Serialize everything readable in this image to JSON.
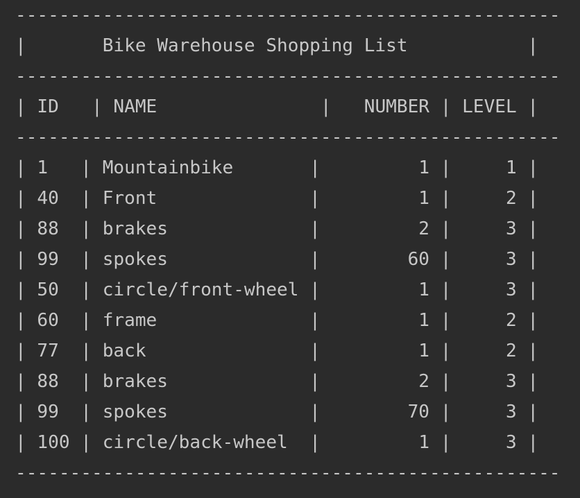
{
  "console": {
    "separator": "--------------------------------------------------",
    "title": "Bike Warehouse Shopping List",
    "columns": [
      "ID",
      "NAME",
      "NUMBER",
      "LEVEL"
    ],
    "rows": [
      {
        "id": "1",
        "name": "Mountainbike",
        "number": "1",
        "level": "1"
      },
      {
        "id": "40",
        "name": "Front",
        "number": "1",
        "level": "2"
      },
      {
        "id": "88",
        "name": "brakes",
        "number": "2",
        "level": "3"
      },
      {
        "id": "99",
        "name": "spokes",
        "number": "60",
        "level": "3"
      },
      {
        "id": "50",
        "name": "circle/front-wheel",
        "number": "1",
        "level": "3"
      },
      {
        "id": "60",
        "name": "frame",
        "number": "1",
        "level": "2"
      },
      {
        "id": "77",
        "name": "back",
        "number": "1",
        "level": "2"
      },
      {
        "id": "88",
        "name": "brakes",
        "number": "2",
        "level": "3"
      },
      {
        "id": "99",
        "name": "spokes",
        "number": "70",
        "level": "3"
      },
      {
        "id": "100",
        "name": "circle/back-wheel",
        "number": "1",
        "level": "3"
      }
    ]
  }
}
